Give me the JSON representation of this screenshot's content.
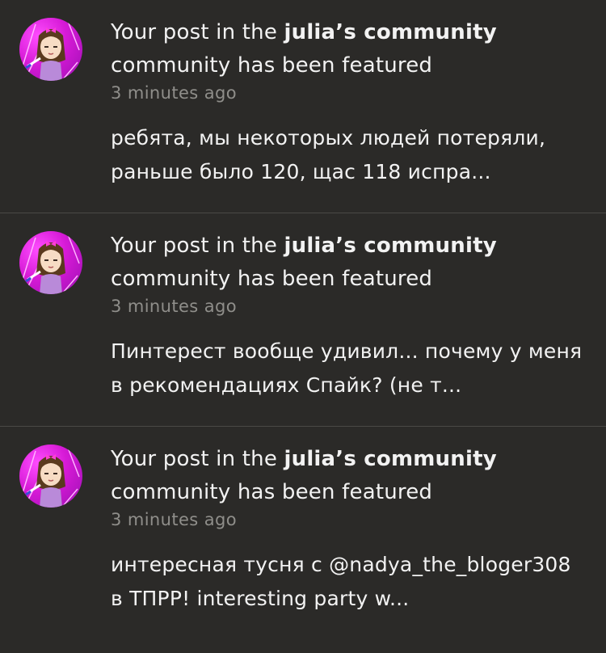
{
  "notifications": [
    {
      "headline_prefix": "Your post in the ",
      "community_name": "julia’s community",
      "headline_suffix": "community has been featured",
      "time": "3 minutes ago",
      "preview": "ребята, мы некоторых людей потеряли, раньше было 120, щас 118 испра..."
    },
    {
      "headline_prefix": "Your post in the ",
      "community_name": "julia’s community",
      "headline_suffix": "community has been featured",
      "time": "3 minutes ago",
      "preview": "Пинтерест вообще удивил... почему у меня в рекомендациях Спайк? (не т..."
    },
    {
      "headline_prefix": "Your post in the ",
      "community_name": "julia’s community",
      "headline_suffix": "community has been featured",
      "time": "3 minutes ago",
      "preview": "интересная тусня с @nadya_the_bloger308 в ТПРР! interesting party w..."
    }
  ],
  "colors": {
    "background": "#2b2a28",
    "divider": "#4a4946",
    "primary_text": "#f2f2f2",
    "secondary_text": "#8f8e8a",
    "avatar_accent": "#d61ad6"
  },
  "icons": {
    "avatar": "user-avatar-drawing"
  }
}
